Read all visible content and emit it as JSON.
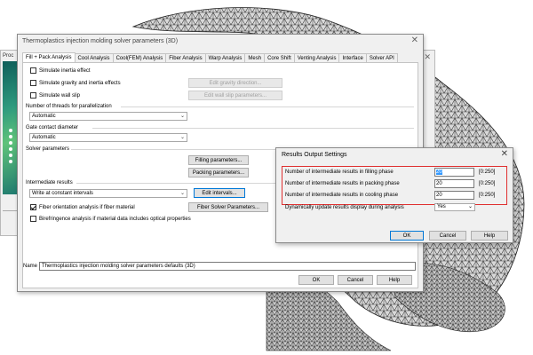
{
  "back_window": {
    "tab_label": "Proc"
  },
  "main_dialog": {
    "title": "Thermoplastics injection molding solver parameters (3D)",
    "close_glyph": "✕",
    "tabs": [
      {
        "label": "Fill + Pack Analysis",
        "active": true
      },
      {
        "label": "Cool Analysis"
      },
      {
        "label": "Cool(FEM) Analysis"
      },
      {
        "label": "Fiber Analysis"
      },
      {
        "label": "Warp Analysis"
      },
      {
        "label": "Mesh"
      },
      {
        "label": "Core Shift"
      },
      {
        "label": "Venting Analysis"
      },
      {
        "label": "Interface"
      },
      {
        "label": "Solver API"
      }
    ],
    "checkboxes": {
      "inertia": {
        "label": "Simulate inertia effect",
        "checked": false
      },
      "gravity": {
        "label": "Simulate gravity and inertia effects",
        "checked": false
      },
      "wall_slip": {
        "label": "Simulate wall slip",
        "checked": false
      },
      "fiber_orientation": {
        "label": "Fiber orientation analysis if fiber material",
        "checked": true
      },
      "birefringence": {
        "label": "Birefringence analysis if material data includes optical properties",
        "checked": false
      }
    },
    "buttons": {
      "gravity_direction": "Edit gravity direction...",
      "wall_slip_params": "Edit wall slip parameters...",
      "filling_params": "Filling parameters...",
      "packing_params": "Packing parameters...",
      "edit_intervals": "Edit intervals...",
      "fiber_solver": "Fiber Solver Parameters...",
      "ok": "OK",
      "cancel": "Cancel",
      "help": "Help"
    },
    "threads": {
      "label": "Number of threads for parallelization",
      "value": "Automatic"
    },
    "gate": {
      "label": "Gate contact diameter",
      "value": "Automatic"
    },
    "solver_params_label": "Solver parameters",
    "intermediate": {
      "label": "Intermediate results",
      "value": "Write at constant intervals"
    },
    "name": {
      "label": "Name",
      "value": "Thermoplastics injection molding solver parameters defaults (3D)"
    }
  },
  "results_dialog": {
    "title": "Results Output Settings",
    "close_glyph": "✕",
    "rows": [
      {
        "label": "Number of intermediate results in filling phase",
        "value": "20",
        "range": "[0:250]"
      },
      {
        "label": "Number of intermediate results in packing phase",
        "value": "20",
        "range": "[0:250]"
      },
      {
        "label": "Number of intermediate results in cooling phase",
        "value": "20",
        "range": "[0:250]"
      }
    ],
    "dynamic": {
      "label": "Dynamically update results display during analysis",
      "value": "Yes"
    },
    "buttons": {
      "ok": "OK",
      "cancel": "Cancel",
      "help": "Help"
    }
  }
}
